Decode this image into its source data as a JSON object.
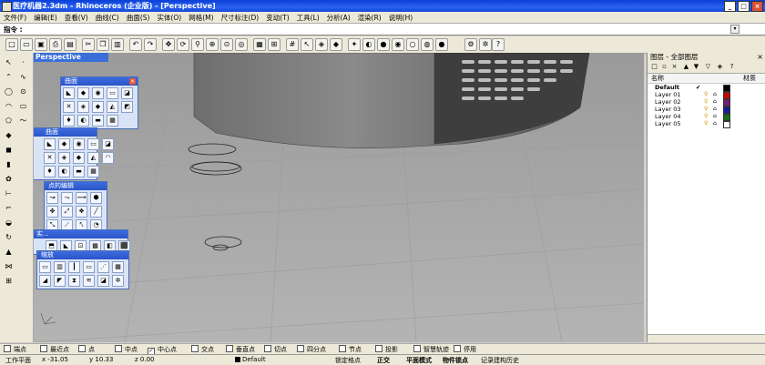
{
  "window": {
    "title": "医疗机器2.3dm - Rhinoceros (企业版) - [Perspective]"
  },
  "menu": [
    "文件(F)",
    "编辑(E)",
    "查看(V)",
    "曲线(C)",
    "曲面(S)",
    "实体(O)",
    "网格(M)",
    "尺寸标注(D)",
    "变动(T)",
    "工具(L)",
    "分析(A)",
    "渲染(R)",
    "说明(H)"
  ],
  "command": {
    "label": "指令 :",
    "value": ""
  },
  "toolbar_icons": [
    "new-icon",
    "open-icon",
    "save-icon",
    "print-icon",
    "import-icon",
    "cut-icon",
    "copy-icon",
    "paste-icon",
    "undo-icon",
    "redo-icon",
    "pan-icon",
    "rotate-view-icon",
    "zoom-icon",
    "zoom-window-icon",
    "zoom-extents-icon",
    "zoom-selected-icon",
    "named-view-icon",
    "four-view-icon",
    "grid-icon",
    "select-icon",
    "layer-icon",
    "properties-icon",
    "light-icon",
    "render-icon",
    "shade-icon",
    "material-icon",
    "environment-icon",
    "ghost-icon",
    "render-preview-icon",
    "options-icon",
    "help-icon"
  ],
  "viewport": {
    "title": "Perspective"
  },
  "palettes": {
    "surface1": {
      "title": "曲面"
    },
    "surface2": {
      "title": "曲面"
    },
    "point_edit": {
      "title": "点的编辑"
    },
    "solid": {
      "title": "实..."
    },
    "scale": {
      "title": "缩放"
    }
  },
  "layers": {
    "header": "图层 - 全部图层",
    "col_name": "名称",
    "col_material": "材质",
    "rows": [
      {
        "name": "Default",
        "current": "✔",
        "color": "#000000"
      },
      {
        "name": "Layer 01",
        "current": "",
        "color": "#cc0000"
      },
      {
        "name": "Layer 02",
        "current": "",
        "color": "#7a1a7a"
      },
      {
        "name": "Layer 03",
        "current": "",
        "color": "#1a1a9a"
      },
      {
        "name": "Layer 04",
        "current": "",
        "color": "#1a6a1a"
      },
      {
        "name": "Layer 05",
        "current": "",
        "color": "#ffffff"
      }
    ]
  },
  "osnaps": [
    {
      "label": "端点",
      "checked": false
    },
    {
      "label": "最近点",
      "checked": false
    },
    {
      "label": "点",
      "checked": false
    },
    {
      "label": "中点",
      "checked": false
    },
    {
      "label": "中心点",
      "checked": true
    },
    {
      "label": "交点",
      "checked": false
    },
    {
      "label": "垂直点",
      "checked": false
    },
    {
      "label": "切点",
      "checked": false
    },
    {
      "label": "四分点",
      "checked": false
    },
    {
      "label": "节点",
      "checked": false
    },
    {
      "label": "投影",
      "checked": false
    },
    {
      "label": "智慧轨迹",
      "checked": false
    },
    {
      "label": "停用",
      "checked": false
    }
  ],
  "status": {
    "plane": "工作平面",
    "x": "x -31.05",
    "y": "y 10.33",
    "z": "z 0.00",
    "layer": "Default",
    "grid_snap": "锁定格点",
    "ortho": "正交",
    "planar": "平面模式",
    "osnap": "物件锁点",
    "history": "记录建构历史"
  }
}
